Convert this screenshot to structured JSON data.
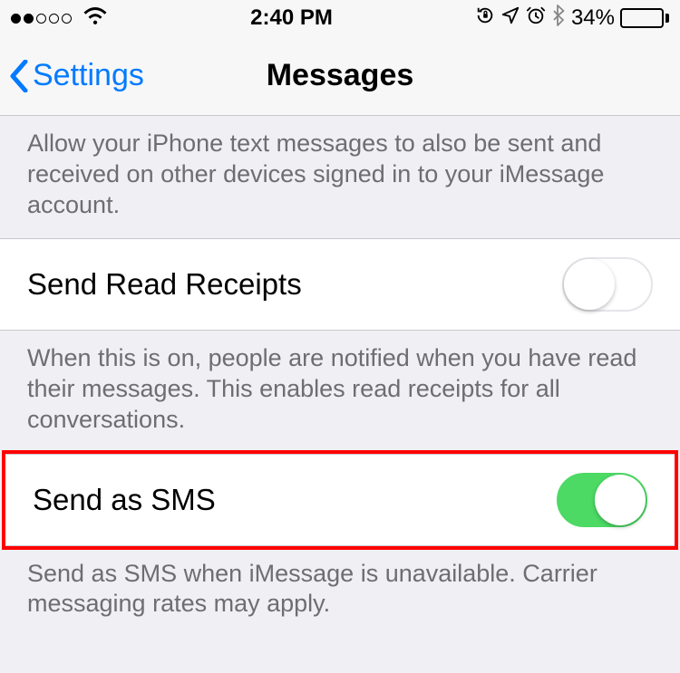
{
  "statusBar": {
    "time": "2:40 PM",
    "batteryPercent": "34%"
  },
  "nav": {
    "backLabel": "Settings",
    "title": "Messages"
  },
  "sections": {
    "textForwardingFooter": "Allow your iPhone text messages to also be sent and received on other devices signed in to your iMessage account.",
    "readReceipts": {
      "label": "Send Read Receipts",
      "footer": "When this is on, people are notified when you have read their messages. This enables read receipts for all conversations."
    },
    "sendAsSms": {
      "label": "Send as SMS",
      "footer": "Send as SMS when iMessage is unavailable. Carrier messaging rates may apply."
    }
  }
}
